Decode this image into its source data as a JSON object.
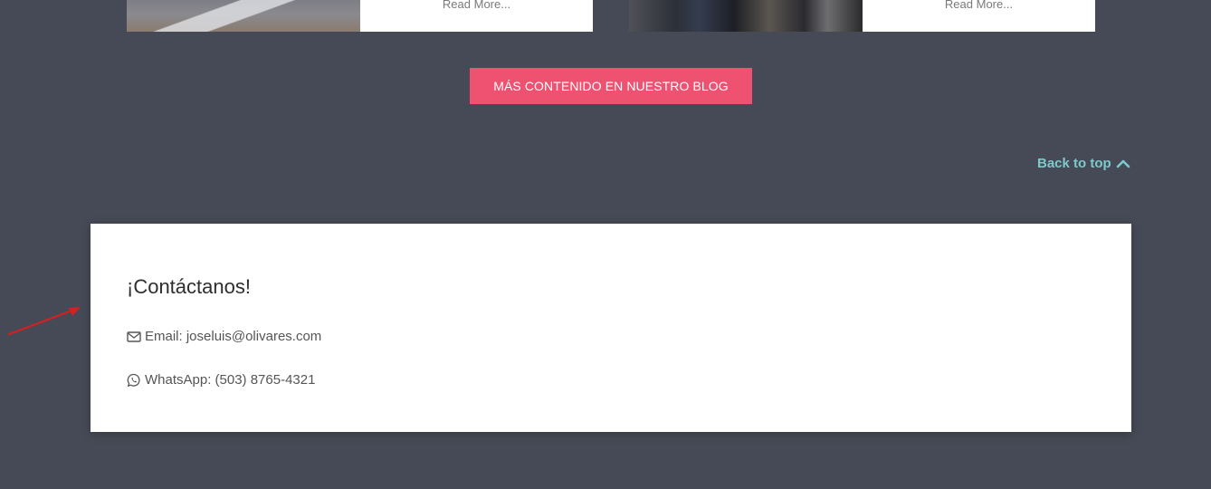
{
  "blog_cards": [
    {
      "read_more_label": "Read More..."
    },
    {
      "read_more_label": "Read More..."
    }
  ],
  "blog_button_label": "MÁS CONTENIDO EN NUESTRO BLOG",
  "back_to_top_label": "Back to top",
  "contact": {
    "title": "¡Contáctanos!",
    "email_text": "Email: joseluis@olivares.com",
    "whatsapp_text": "WhatsApp: (503) 8765-4321"
  },
  "icons": {
    "back_to_top": "chevron-up-icon",
    "email": "envelope-icon",
    "whatsapp": "whatsapp-icon",
    "annotation": "red-arrow-annotation"
  },
  "colors": {
    "page_background": "#464a56",
    "accent_button": "#ef5171",
    "back_to_top": "#7cc9cb",
    "annotation_arrow": "#d42020"
  }
}
